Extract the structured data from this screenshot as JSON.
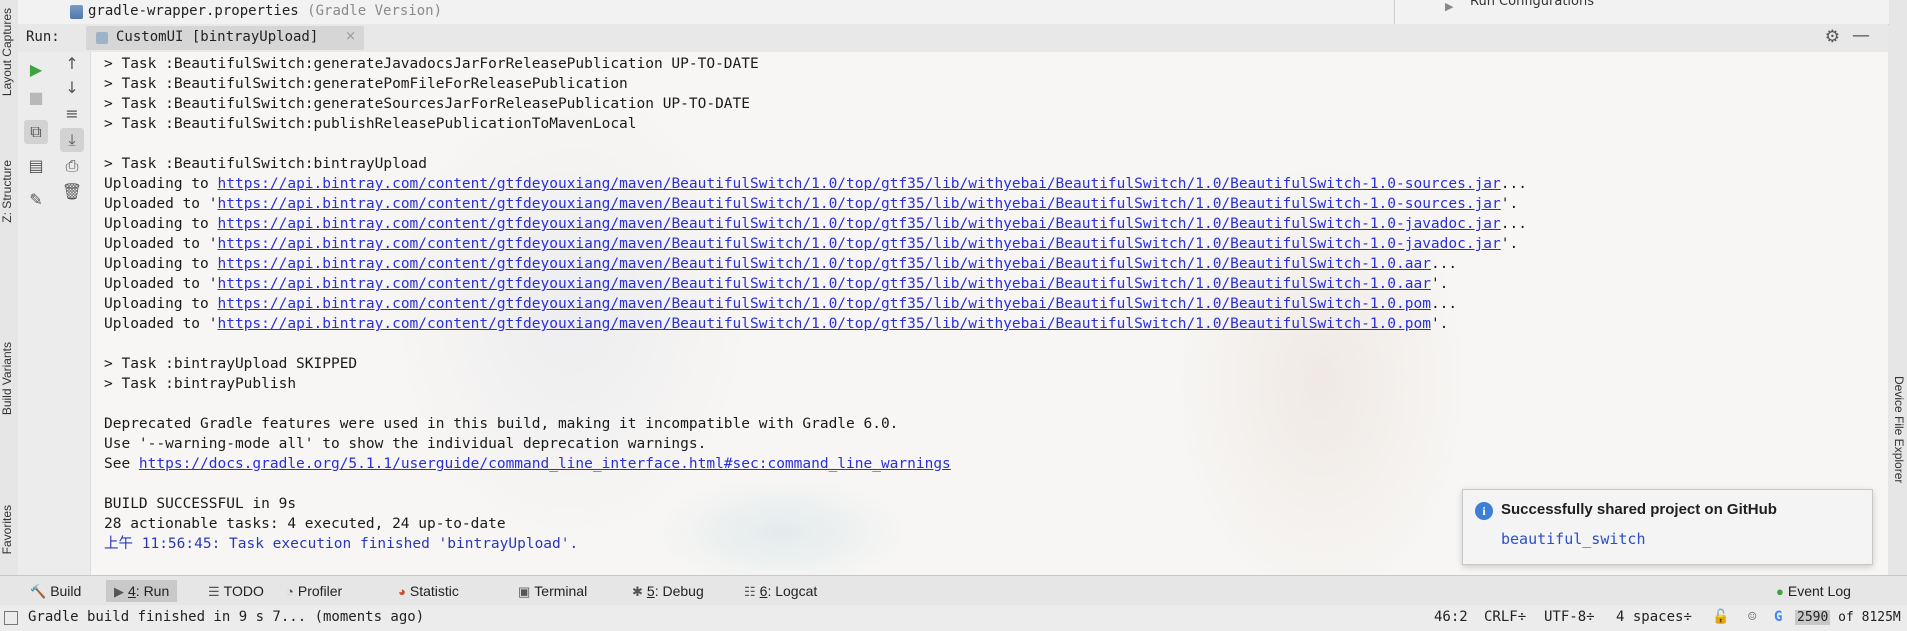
{
  "left_strip": {
    "layout_captures": "Layout Captures",
    "structure": "Z: Structure",
    "build_variants": "Build Variants",
    "favorites": "Favorites"
  },
  "right_strip": {
    "device_file_explorer": "Device File Explorer"
  },
  "editor_tab": {
    "file_name": "gradle-wrapper.properties",
    "file_hint": "(Gradle Version)"
  },
  "right_panel": {
    "item": "Run Configurations"
  },
  "run_panel": {
    "label": "Run:",
    "tab_label": "CustomUI [bintrayUpload]",
    "close_glyph": "×",
    "settings_glyph": "⚙",
    "minimize_glyph": "—"
  },
  "console": {
    "lines": [
      {
        "text": "> Task :BeautifulSwitch:generateJavadocsJarForReleasePublication UP-TO-DATE"
      },
      {
        "text": "> Task :BeautifulSwitch:generatePomFileForReleasePublication"
      },
      {
        "text": "> Task :BeautifulSwitch:generateSourcesJarForReleasePublication UP-TO-DATE"
      },
      {
        "text": "> Task :BeautifulSwitch:publishReleasePublicationToMavenLocal"
      },
      {
        "text": ""
      },
      {
        "text": "> Task :BeautifulSwitch:bintrayUpload"
      },
      {
        "prefix": "Uploading to ",
        "link": "https://api.bintray.com/content/gtfdeyouxiang/maven/BeautifulSwitch/1.0/top/gtf35/lib/withyebai/BeautifulSwitch/1.0/BeautifulSwitch-1.0-sources.jar",
        "suffix": "..."
      },
      {
        "prefix": "Uploaded to '",
        "link": "https://api.bintray.com/content/gtfdeyouxiang/maven/BeautifulSwitch/1.0/top/gtf35/lib/withyebai/BeautifulSwitch/1.0/BeautifulSwitch-1.0-sources.jar",
        "suffix": "'."
      },
      {
        "prefix": "Uploading to ",
        "link": "https://api.bintray.com/content/gtfdeyouxiang/maven/BeautifulSwitch/1.0/top/gtf35/lib/withyebai/BeautifulSwitch/1.0/BeautifulSwitch-1.0-javadoc.jar",
        "suffix": "..."
      },
      {
        "prefix": "Uploaded to '",
        "link": "https://api.bintray.com/content/gtfdeyouxiang/maven/BeautifulSwitch/1.0/top/gtf35/lib/withyebai/BeautifulSwitch/1.0/BeautifulSwitch-1.0-javadoc.jar",
        "suffix": "'."
      },
      {
        "prefix": "Uploading to ",
        "link": "https://api.bintray.com/content/gtfdeyouxiang/maven/BeautifulSwitch/1.0/top/gtf35/lib/withyebai/BeautifulSwitch/1.0/BeautifulSwitch-1.0.aar",
        "suffix": "..."
      },
      {
        "prefix": "Uploaded to '",
        "link": "https://api.bintray.com/content/gtfdeyouxiang/maven/BeautifulSwitch/1.0/top/gtf35/lib/withyebai/BeautifulSwitch/1.0/BeautifulSwitch-1.0.aar",
        "suffix": "'."
      },
      {
        "prefix": "Uploading to ",
        "link": "https://api.bintray.com/content/gtfdeyouxiang/maven/BeautifulSwitch/1.0/top/gtf35/lib/withyebai/BeautifulSwitch/1.0/BeautifulSwitch-1.0.pom",
        "suffix": "..."
      },
      {
        "prefix": "Uploaded to '",
        "link": "https://api.bintray.com/content/gtfdeyouxiang/maven/BeautifulSwitch/1.0/top/gtf35/lib/withyebai/BeautifulSwitch/1.0/BeautifulSwitch-1.0.pom",
        "suffix": "'."
      },
      {
        "text": ""
      },
      {
        "text": "> Task :bintrayUpload SKIPPED"
      },
      {
        "text": "> Task :bintrayPublish"
      },
      {
        "text": ""
      },
      {
        "text": "Deprecated Gradle features were used in this build, making it incompatible with Gradle 6.0."
      },
      {
        "text": "Use '--warning-mode all' to show the individual deprecation warnings."
      },
      {
        "prefix": "See ",
        "link": "https://docs.gradle.org/5.1.1/userguide/command_line_interface.html#sec:command_line_warnings",
        "suffix": ""
      },
      {
        "text": ""
      },
      {
        "text": "BUILD SUCCESSFUL in 9s"
      },
      {
        "text": "28 actionable tasks: 4 executed, 24 up-to-date"
      },
      {
        "text": "上午 11:56:45: Task execution finished 'bintrayUpload'.",
        "color": "blue"
      }
    ]
  },
  "notification": {
    "title": "Successfully shared project on GitHub",
    "link": "beautiful_switch"
  },
  "tool_tabs": {
    "build": "Build",
    "run_num": "4",
    "run": ": Run",
    "todo": "TODO",
    "profiler": "Profiler",
    "statistic": "Statistic",
    "terminal": "Terminal",
    "debug_num": "5",
    "debug": ": Debug",
    "logcat_num": "6",
    "logcat": ": Logcat",
    "event_log": "Event Log"
  },
  "status_bar": {
    "message": "Gradle build finished in 9 s 7... (moments ago)",
    "position": "46:2",
    "line_sep": "CRLF",
    "encoding": "UTF-8",
    "indent": "4 spaces",
    "mem_used": "2590",
    "mem_total": " of 8125M"
  },
  "colors": {
    "link": "#2a2fd6",
    "info_blue": "#3d7fd4",
    "run_green": "#3fa33f"
  }
}
